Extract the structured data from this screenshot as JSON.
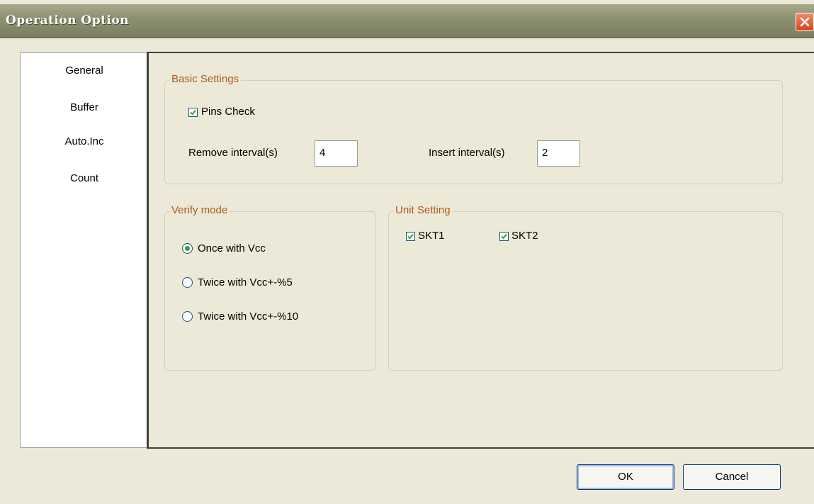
{
  "window": {
    "title": "Operation Option"
  },
  "nav": {
    "items": [
      {
        "label": "General"
      },
      {
        "label": "Buffer"
      },
      {
        "label": "Auto.Inc"
      },
      {
        "label": "Count"
      }
    ]
  },
  "basic_settings": {
    "legend": "Basic Settings",
    "pins_check": {
      "label": "Pins Check",
      "checked": true
    },
    "remove_interval": {
      "label": "Remove interval(s)",
      "value": "4"
    },
    "insert_interval": {
      "label": "Insert interval(s)",
      "value": "2"
    }
  },
  "verify_mode": {
    "legend": "Verify mode",
    "options": [
      {
        "label": "Once with Vcc",
        "selected": true
      },
      {
        "label": "Twice with Vcc+-%5",
        "selected": false
      },
      {
        "label": "Twice with Vcc+-%10",
        "selected": false
      }
    ]
  },
  "unit_setting": {
    "legend": "Unit Setting",
    "units": [
      {
        "label": "SKT1",
        "checked": true
      },
      {
        "label": "SKT2",
        "checked": true
      }
    ]
  },
  "buttons": {
    "ok": "OK",
    "cancel": "Cancel"
  },
  "colors": {
    "accent_legend": "#b05a1a",
    "titlebar": "#8d9070",
    "close": "#d8431f",
    "check": "#3aa02e"
  }
}
